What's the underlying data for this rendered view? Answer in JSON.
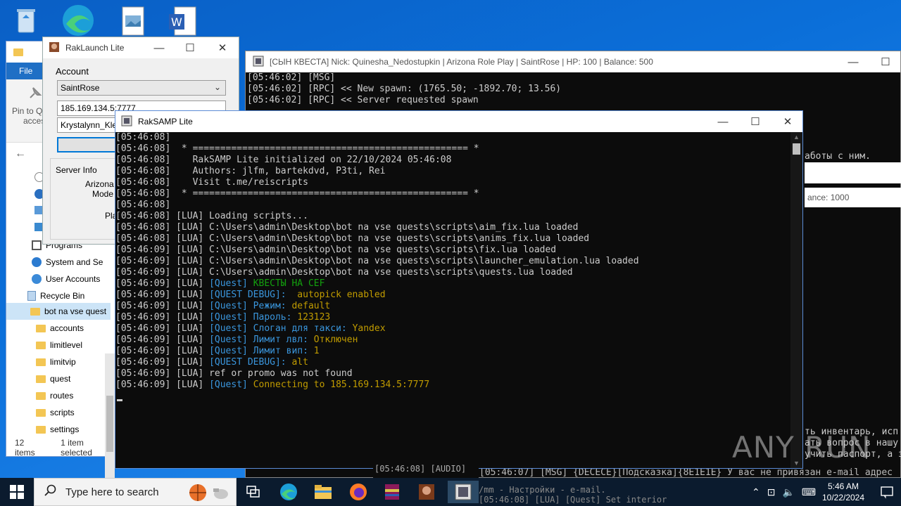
{
  "explorer": {
    "ribbon_file": "File",
    "pin_label_1": "Pin to Qu",
    "pin_label_2": "access",
    "nav_items": [
      {
        "label": "Programs"
      },
      {
        "label": "System and Se"
      },
      {
        "label": "User Accounts"
      },
      {
        "label": "Recycle Bin"
      },
      {
        "label": "bot na vse quest"
      },
      {
        "label": "accounts"
      },
      {
        "label": "limitlevel"
      },
      {
        "label": "limitvip"
      },
      {
        "label": "quest"
      },
      {
        "label": "routes"
      },
      {
        "label": "scripts"
      },
      {
        "label": "settings"
      }
    ],
    "status_count": "12 items",
    "status_selected": "1 item selected"
  },
  "launch": {
    "title": "RakLaunch Lite",
    "account_label": "Account",
    "server_select": "SaintRose",
    "ip_field": "185.169.134.5:7777",
    "nick_field": "Krystalynn_Klej",
    "server_info_label": "Server Info",
    "info_name": "Arizona",
    "info_mode": "Mode",
    "info_players": "Pla"
  },
  "console_back": {
    "title": "[СЫН КВЕСТА] Nick: Quinesha_Nedostupkin | Arizona Role Play | SaintRose | HP: 100 | Balance: 500",
    "lines": [
      "[05:46:02] [MSG]",
      "",
      "[05:46:02] [RPC] << New spawn: (1765.50; -1892.70; 13.56)",
      "[05:46:02] [RPC] << Server requested spawn"
    ],
    "right_text_1": "аботы с ним.",
    "right_text_2": "ance: 1000",
    "bottom_lines": [
      "ть инвентарь, исп",
      "ать вопрос в нашу",
      "учить паспорт, а з"
    ]
  },
  "console_bottom_strip": {
    "left": "[05:46:08] [AUDIO]",
    "right_1": "[05:46:07] [MSG] {DECECE}[Подсказка]{8E1E1E} У вас не привязан e-mail адрес",
    "right_2": "/mm - Настройки - e-mail.",
    "right_3": "[05:46:08] [LUA]  [Quest] Set interior"
  },
  "console_main": {
    "title": "RakSAMP Lite",
    "lines": [
      [
        {
          "t": "[05:46:08]",
          "c": "w"
        }
      ],
      [
        {
          "t": "[05:46:08]  * ================================================== *",
          "c": "w"
        }
      ],
      [
        {
          "t": "[05:46:08]    RakSAMP Lite initialized on 22/10/2024 05:46:08",
          "c": "w"
        }
      ],
      [
        {
          "t": "[05:46:08]    Authors: jlfm, bartekdvd, P3ti, Rei",
          "c": "w"
        }
      ],
      [
        {
          "t": "[05:46:08]    Visit t.me/reiscripts",
          "c": "w"
        }
      ],
      [
        {
          "t": "[05:46:08]  * ================================================== *",
          "c": "w"
        }
      ],
      [
        {
          "t": "[05:46:08]",
          "c": "w"
        }
      ],
      [
        {
          "t": "[05:46:08] [LUA] Loading scripts...",
          "c": "w"
        }
      ],
      [
        {
          "t": "[05:46:08] [LUA] C:\\Users\\admin\\Desktop\\bot na vse quests\\scripts\\aim_fix.lua loaded",
          "c": "w"
        }
      ],
      [
        {
          "t": "[05:46:08] [LUA] C:\\Users\\admin\\Desktop\\bot na vse quests\\scripts\\anims_fix.lua loaded",
          "c": "w"
        }
      ],
      [
        {
          "t": "[05:46:09] [LUA] C:\\Users\\admin\\Desktop\\bot na vse quests\\scripts\\fix.lua loaded",
          "c": "w"
        }
      ],
      [
        {
          "t": "[05:46:09] [LUA] C:\\Users\\admin\\Desktop\\bot na vse quests\\scripts\\launcher_emulation.lua loaded",
          "c": "w"
        }
      ],
      [
        {
          "t": "[05:46:09] [LUA] C:\\Users\\admin\\Desktop\\bot na vse quests\\scripts\\quests.lua loaded",
          "c": "w"
        }
      ],
      [
        {
          "t": "[05:46:09] [LUA] ",
          "c": "w"
        },
        {
          "t": "[Quest] ",
          "c": "q"
        },
        {
          "t": "КВЕСТЫ НА CEF",
          "c": "g"
        }
      ],
      [
        {
          "t": "[05:46:09] [LUA] ",
          "c": "w"
        },
        {
          "t": "[QUEST DEBUG]: ",
          "c": "q"
        },
        {
          "t": " autopick enabled",
          "c": "y"
        }
      ],
      [
        {
          "t": "[05:46:09] [LUA] ",
          "c": "w"
        },
        {
          "t": "[Quest] Режим: ",
          "c": "q"
        },
        {
          "t": "default",
          "c": "y"
        }
      ],
      [
        {
          "t": "[05:46:09] [LUA] ",
          "c": "w"
        },
        {
          "t": "[Quest] Пароль: ",
          "c": "q"
        },
        {
          "t": "123123",
          "c": "y"
        }
      ],
      [
        {
          "t": "[05:46:09] [LUA] ",
          "c": "w"
        },
        {
          "t": "[Quest] Слоган для такси: ",
          "c": "q"
        },
        {
          "t": "Yandex",
          "c": "y"
        }
      ],
      [
        {
          "t": "[05:46:09] [LUA] ",
          "c": "w"
        },
        {
          "t": "[Quest] Лимит лвл: ",
          "c": "q"
        },
        {
          "t": "Отключен",
          "c": "y"
        }
      ],
      [
        {
          "t": "[05:46:09] [LUA] ",
          "c": "w"
        },
        {
          "t": "[Quest] Лимит вип: ",
          "c": "q"
        },
        {
          "t": "1",
          "c": "y"
        }
      ],
      [
        {
          "t": "[05:46:09] [LUA] ",
          "c": "w"
        },
        {
          "t": "[QUEST DEBUG]: ",
          "c": "q"
        },
        {
          "t": "alt",
          "c": "y"
        }
      ],
      [
        {
          "t": "[05:46:09] [LUA] ref or promo was not found",
          "c": "w"
        }
      ],
      [
        {
          "t": "[05:46:09] [LUA] ",
          "c": "w"
        },
        {
          "t": "[Quest] ",
          "c": "q"
        },
        {
          "t": "Connecting to 185.169.134.5:7777",
          "c": "y"
        }
      ]
    ]
  },
  "watermark": "ANY RUN",
  "taskbar": {
    "search_placeholder": "Type here to search",
    "time": "5:46 AM",
    "date": "10/22/2024"
  },
  "colors": {
    "console_bg": "#0c0c0c",
    "quest_blue": "#3a96dd",
    "value_yellow": "#c19c00",
    "green": "#13a10e"
  }
}
